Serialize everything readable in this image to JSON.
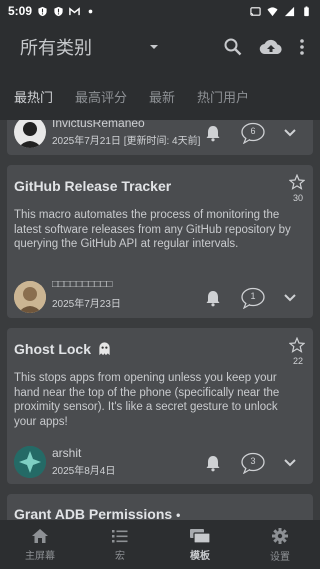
{
  "status": {
    "time": "5:09"
  },
  "appbar": {
    "title": "所有类别"
  },
  "tabs": [
    "最热门",
    "最高评分",
    "最新",
    "热门用户"
  ],
  "cards": [
    {
      "author": "InvictusRemaneo",
      "date": "2025年7月21日 [更新时间: 4天前]",
      "comments": "6"
    },
    {
      "title": "GitHub Release Tracker",
      "stars": "30",
      "description": "This macro automates the process of monitoring the latest software releases from any GitHub repository by querying the GitHub API at regular intervals.",
      "author": "□□□□□□□□□□",
      "date": "2025年7月23日",
      "comments": "1"
    },
    {
      "title": "Ghost Lock",
      "stars": "22",
      "description": "This stops apps from opening unless you keep your hand near the top of the phone (specifically near the proximity sensor). It's like a secret gesture to unlock your apps!",
      "author": "arshit",
      "date": "2025年8月4日",
      "comments": "3"
    },
    {
      "title": "Grant ADB Permissions"
    }
  ],
  "bottomnav": [
    "主屏幕",
    "宏",
    "模板",
    "设置"
  ]
}
